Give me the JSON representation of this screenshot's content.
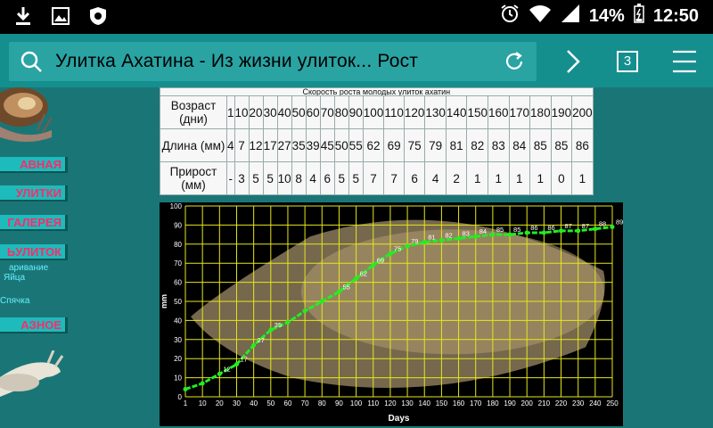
{
  "status_bar": {
    "icons_left": [
      "download-icon",
      "image-icon",
      "shield-icon"
    ],
    "battery": "14%",
    "time": "12:50"
  },
  "browser": {
    "url_title": "Улитка Ахатина - Из жизни улиток... Рост",
    "tab_count": "3"
  },
  "sidebar": {
    "items": [
      "АВНАЯ",
      "УЛИТКИ",
      "ГАЛЕРЕЯ",
      "ЬУЛИТОК",
      "АЗНОЕ"
    ],
    "subitems": [
      "аривание",
      "Яйца",
      "Спячка"
    ]
  },
  "table": {
    "caption": "Скорость роста молодых улиток ахатин",
    "rows": [
      {
        "label": "Возраст (дни)",
        "values": [
          "1",
          "10",
          "20",
          "30",
          "40",
          "50",
          "60",
          "70",
          "80",
          "90",
          "100",
          "110",
          "120",
          "130",
          "140",
          "150",
          "160",
          "170",
          "180",
          "190",
          "200"
        ]
      },
      {
        "label": "Длина (мм)",
        "values": [
          "4",
          "7",
          "12",
          "17",
          "27",
          "35",
          "39",
          "45",
          "50",
          "55",
          "62",
          "69",
          "75",
          "79",
          "81",
          "82",
          "83",
          "84",
          "85",
          "85",
          "86"
        ]
      },
      {
        "label": "Прирост (мм)",
        "values": [
          "-",
          "3",
          "5",
          "5",
          "10",
          "8",
          "4",
          "6",
          "5",
          "5",
          "7",
          "7",
          "6",
          "4",
          "2",
          "1",
          "1",
          "1",
          "1",
          "0",
          "1"
        ]
      }
    ]
  },
  "chart_data": {
    "type": "line",
    "xlabel": "Days",
    "ylabel": "mm",
    "xlim": [
      1,
      250
    ],
    "ylim": [
      0,
      100
    ],
    "x_ticks": [
      "1",
      "10",
      "20",
      "30",
      "40",
      "50",
      "60",
      "70",
      "80",
      "90",
      "100",
      "110",
      "120",
      "130",
      "140",
      "150",
      "160",
      "170",
      "180",
      "190",
      "200",
      "210",
      "220",
      "230",
      "240",
      "250"
    ],
    "y_ticks": [
      "0",
      "10",
      "20",
      "30",
      "40",
      "50",
      "60",
      "70",
      "80",
      "90",
      "100"
    ],
    "series": [
      {
        "x": [
          1,
          10,
          20,
          30,
          40,
          50,
          60,
          70,
          80,
          90,
          100,
          110,
          120,
          130,
          140,
          150,
          160,
          170,
          180,
          190,
          200,
          210,
          220,
          230,
          240,
          250
        ],
        "y": [
          4,
          7,
          12,
          17,
          27,
          35,
          39,
          45,
          50,
          55,
          62,
          69,
          75,
          79,
          81,
          82,
          83,
          84,
          85,
          85,
          86,
          86,
          87,
          87,
          88,
          89
        ],
        "labels": [
          "",
          "",
          "12",
          "17",
          "27",
          "35",
          "",
          "",
          "",
          "55",
          "62",
          "69",
          "75",
          "79",
          "81",
          "82",
          "83",
          "84",
          "85",
          "85",
          "86",
          "86",
          "87",
          "87",
          "88",
          "89"
        ],
        "color": "#22ee22"
      }
    ],
    "grid": true,
    "grid_color": "#e6e61a"
  }
}
